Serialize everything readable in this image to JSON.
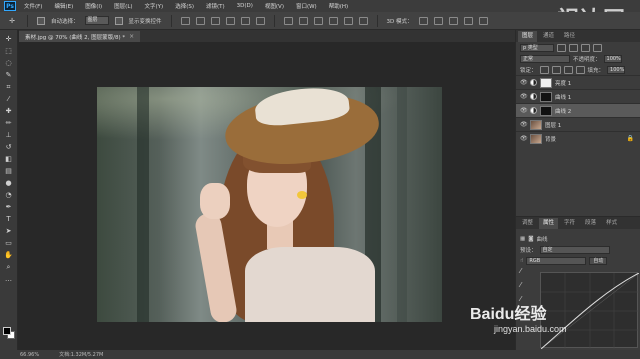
{
  "app": {
    "logo": "Ps"
  },
  "menubar": {
    "items": [
      "文件(F)",
      "编辑(E)",
      "图像(I)",
      "图层(L)",
      "文字(Y)",
      "选择(S)",
      "滤镜(T)",
      "3D(D)",
      "视图(V)",
      "窗口(W)",
      "帮助(H)"
    ]
  },
  "options": {
    "auto_select_label": "自动选择：",
    "auto_select_value": "图层",
    "show_transform_label": "显示变换控件"
  },
  "watermark_top": "视达网",
  "document": {
    "tab_title": "素材.jpg @ 70% (曲线 2, 图层蒙版/8) *",
    "close": "×"
  },
  "layers_panel": {
    "tabs": [
      "图层",
      "通道",
      "路径"
    ],
    "filter_label": "p 类型",
    "blend_mode": "正常",
    "opacity_label": "不透明度：",
    "opacity_value": "100%",
    "lock_label": "锁定：",
    "fill_label": "填充：",
    "fill_value": "100%",
    "layers": [
      {
        "name": "亮度 1",
        "thumb": "white",
        "selected": false
      },
      {
        "name": "曲线 1",
        "thumb": "black",
        "selected": false
      },
      {
        "name": "曲线 2",
        "thumb": "black",
        "selected": true
      },
      {
        "name": "图层 1",
        "thumb": "photo",
        "selected": false
      },
      {
        "name": "背景",
        "thumb": "photo",
        "selected": false
      }
    ]
  },
  "properties_panel": {
    "tabs": [
      "调整",
      "属性",
      "字符",
      "段落",
      "样式"
    ],
    "title": "曲线",
    "preset_label": "预设：",
    "preset_value": "自定",
    "channel_value": "RGB",
    "auto_label": "自动"
  },
  "statusbar": {
    "zoom": "66.96%",
    "doc_info": "文档:1.32M/5.27M"
  },
  "watermark_bottom": {
    "logo": "Baidu经验",
    "sub": "jingyan.baidu.com"
  }
}
